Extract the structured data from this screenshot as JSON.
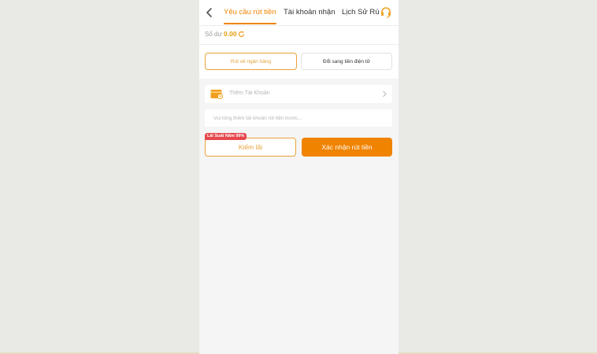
{
  "header": {
    "tabs": [
      {
        "label": "Yêu cầu rút tiền",
        "active": true
      },
      {
        "label": "Tài khoản nhận",
        "active": false
      },
      {
        "label": "Lịch Sử Rú",
        "active": false
      }
    ]
  },
  "balance": {
    "label": "Số dư",
    "value": "0.00"
  },
  "withdraw_methods": {
    "bank": "Rút về ngân hàng",
    "ewallet": "Đổi sang tiền điện tử"
  },
  "account": {
    "placeholder": "Thêm Tài Khoản"
  },
  "hint": {
    "placeholder": "Vui lòng thêm tài khoản rút tiền trước..."
  },
  "actions": {
    "interest_badge": "Lãi Suất Năm 99%",
    "earn_label": "Kiếm lãi",
    "confirm_label": "Xác nhận rút tiền"
  },
  "colors": {
    "accent": "#f08300",
    "badge": "#e5484d",
    "balance": "#e79b0b"
  },
  "icons": [
    "chevron-left-icon",
    "headset-icon",
    "refresh-icon",
    "wallet-icon",
    "chevron-right-icon"
  ]
}
